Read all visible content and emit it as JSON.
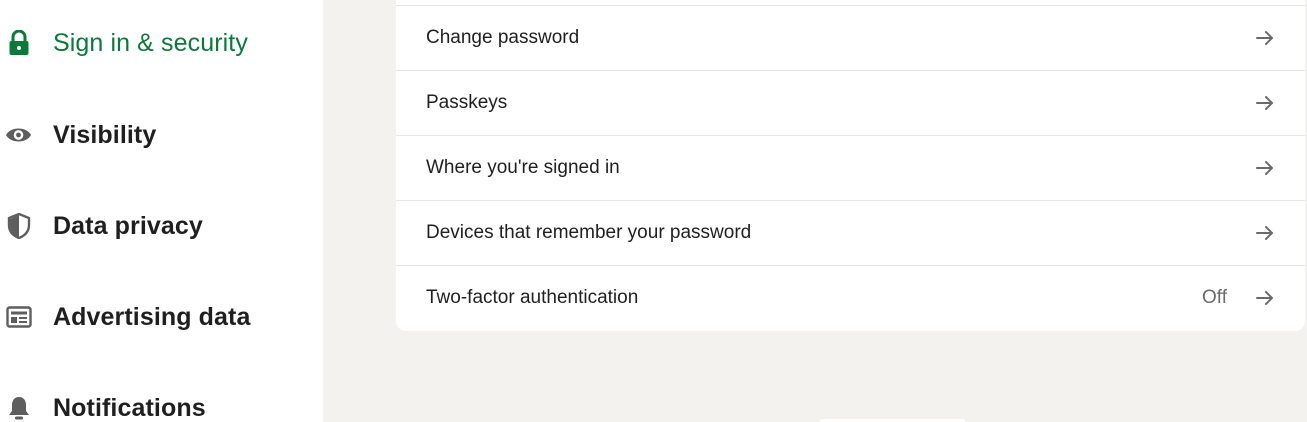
{
  "sidebar": {
    "items": [
      {
        "label": "Sign in & security",
        "icon": "lock-icon",
        "active": true
      },
      {
        "label": "Visibility",
        "icon": "eye-icon",
        "active": false
      },
      {
        "label": "Data privacy",
        "icon": "shield-icon",
        "active": false
      },
      {
        "label": "Advertising data",
        "icon": "newspaper-icon",
        "active": false
      },
      {
        "label": "Notifications",
        "icon": "bell-icon",
        "active": false
      }
    ]
  },
  "security": {
    "rows": [
      {
        "label": "Change password",
        "value": ""
      },
      {
        "label": "Passkeys",
        "value": ""
      },
      {
        "label": "Where you're signed in",
        "value": ""
      },
      {
        "label": "Devices that remember your password",
        "value": ""
      },
      {
        "label": "Two-factor authentication",
        "value": "Off"
      }
    ]
  },
  "colors": {
    "active": "#0a7a3a",
    "text": "#1f1f1f",
    "muted": "#6b6b6b",
    "background": "#f4f2ee"
  }
}
